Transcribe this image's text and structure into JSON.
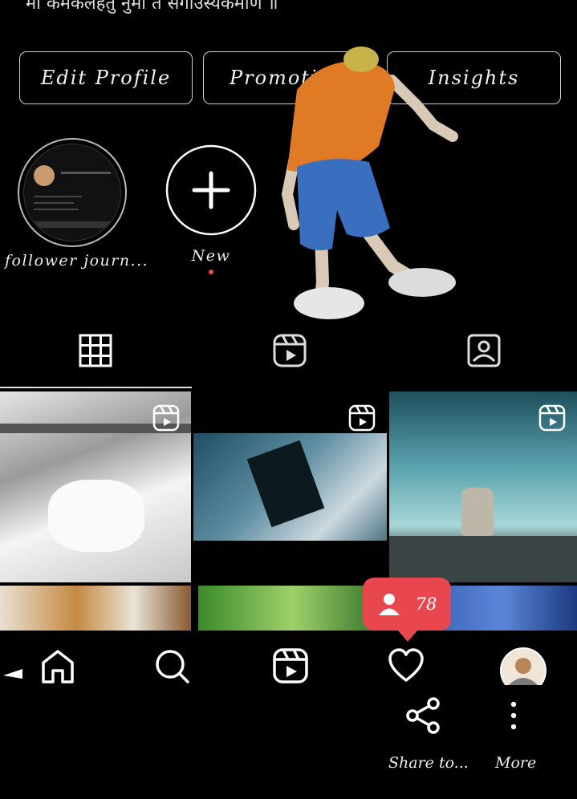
{
  "profile": {
    "bio_line": "मा कमकलहतु नुमा त सगाउस्यकमाण ॥"
  },
  "actions": {
    "edit_profile": "Edit Profile",
    "promotions": "Promotio",
    "insights": "Insights"
  },
  "highlights": [
    {
      "label": "follower journ..."
    },
    {
      "label": "New"
    }
  ],
  "tabs": [
    {
      "icon": "grid-icon",
      "active": true
    },
    {
      "icon": "reels-icon",
      "active": false
    },
    {
      "icon": "tagged-icon",
      "active": false
    }
  ],
  "notification": {
    "icon": "person-icon",
    "count": "78",
    "color": "#e8474f"
  },
  "bottom_nav": [
    {
      "icon": "home-icon"
    },
    {
      "icon": "search-icon"
    },
    {
      "icon": "reels-icon"
    },
    {
      "icon": "heart-icon"
    },
    {
      "icon": "avatar"
    }
  ],
  "share_sheet": {
    "share_label": "Share to...",
    "more_label": "More"
  }
}
